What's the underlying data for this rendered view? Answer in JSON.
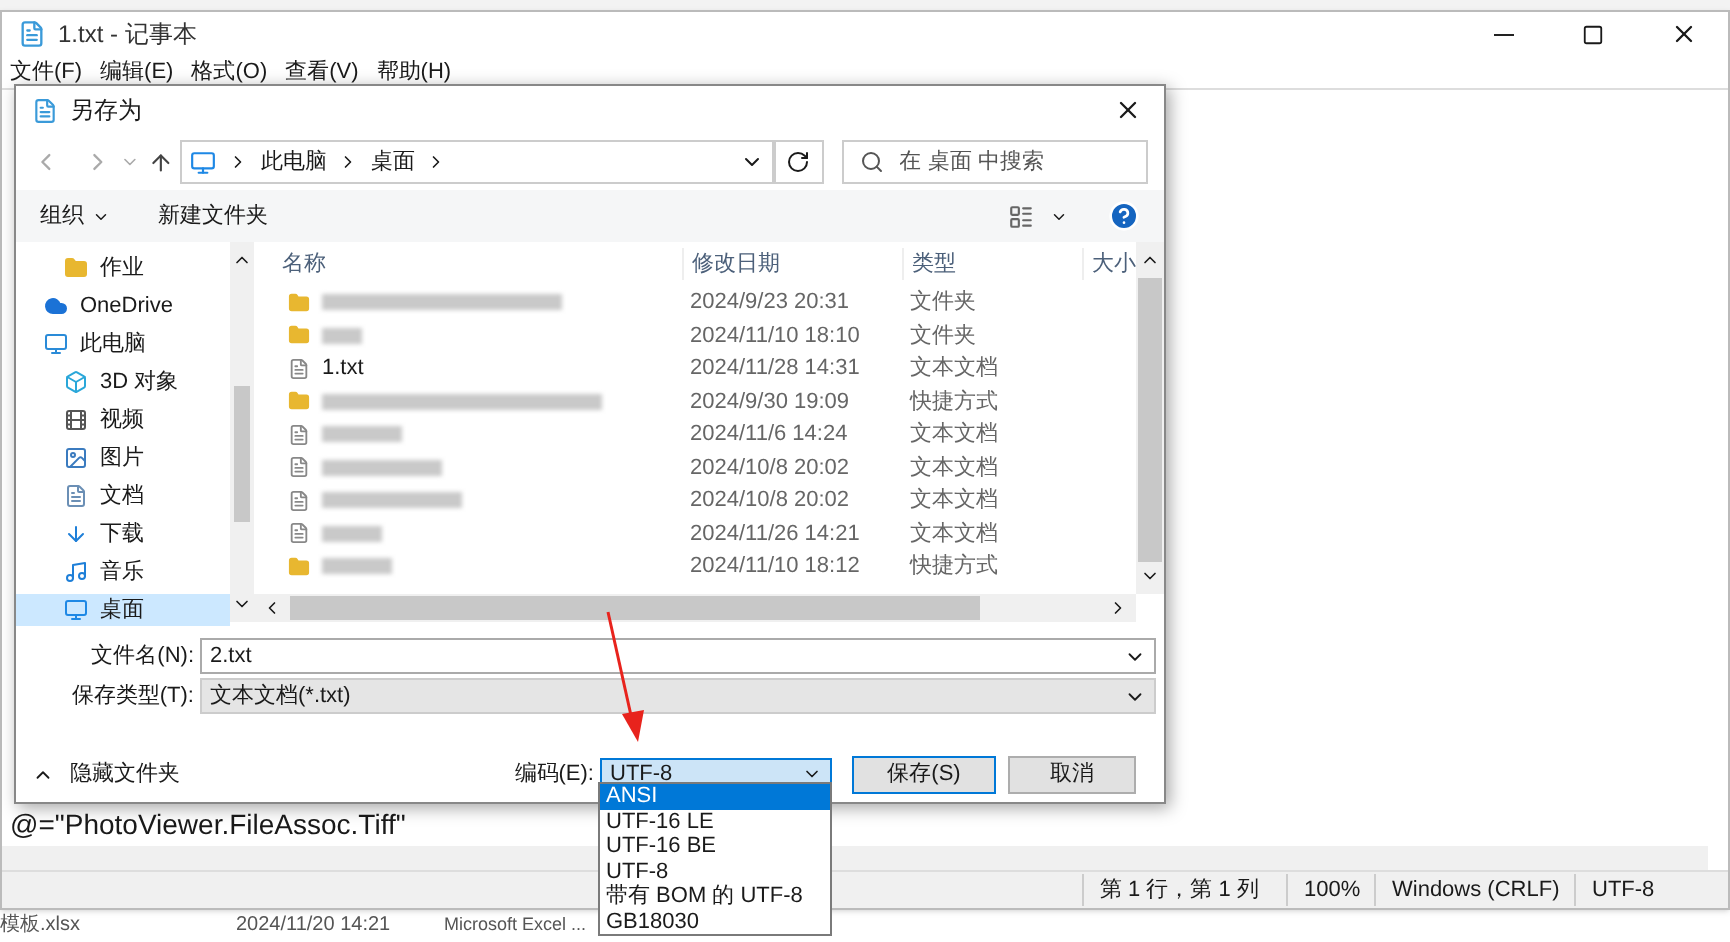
{
  "notepad": {
    "title": "1.txt - 记事本",
    "menu": [
      "文件(F)",
      "编辑(E)",
      "格式(O)",
      "查看(V)",
      "帮助(H)"
    ],
    "text_line": "@=\"PhotoViewer.FileAssoc.Tiff\"",
    "status_bar": [
      "第 1 行，第 1 列",
      "100%",
      "Windows (CRLF)",
      "UTF-8"
    ]
  },
  "dialog": {
    "title": "另存为",
    "breadcrumb": [
      "此电脑",
      "桌面"
    ],
    "search": {
      "placeholder": "在 桌面 中搜索"
    },
    "toolbar": {
      "organize": "组织",
      "new_folder": "新建文件夹"
    },
    "nav": [
      {
        "kind": "folder",
        "label": "作业",
        "selected": false
      },
      {
        "kind": "cloud",
        "label": "OneDrive",
        "selected": false
      },
      {
        "kind": "pc",
        "label": "此电脑",
        "selected": false
      },
      {
        "kind": "cube",
        "label": "3D 对象",
        "selected": false
      },
      {
        "kind": "video",
        "label": "视频",
        "selected": false
      },
      {
        "kind": "image",
        "label": "图片",
        "selected": false
      },
      {
        "kind": "doc",
        "label": "文档",
        "selected": false
      },
      {
        "kind": "download",
        "label": "下载",
        "selected": false
      },
      {
        "kind": "music",
        "label": "音乐",
        "selected": false
      },
      {
        "kind": "desktop",
        "label": "桌面",
        "selected": true
      }
    ],
    "columns": [
      "名称",
      "修改日期",
      "类型",
      "大小"
    ],
    "files": [
      {
        "kind": "folder",
        "date": "2024/9/23 20:31",
        "type": "文件夹"
      },
      {
        "kind": "folder",
        "date": "2024/11/10 18:10",
        "type": "文件夹"
      },
      {
        "kind": "text",
        "name": "1.txt",
        "date": "2024/11/28 14:31",
        "type": "文本文档"
      },
      {
        "kind": "shortcut",
        "date": "2024/9/30 19:09",
        "type": "快捷方式"
      },
      {
        "kind": "text",
        "date": "2024/11/6 14:24",
        "type": "文本文档"
      },
      {
        "kind": "text",
        "date": "2024/10/8 20:02",
        "type": "文本文档"
      },
      {
        "kind": "text",
        "date": "2024/10/8 20:02",
        "type": "文本文档"
      },
      {
        "kind": "text",
        "date": "2024/11/26 14:21",
        "type": "文本文档"
      },
      {
        "kind": "shortcut",
        "date": "2024/11/10 18:12",
        "type": "快捷方式"
      }
    ],
    "filename": {
      "label": "文件名(N):",
      "value": "2.txt"
    },
    "filetype": {
      "label": "保存类型(T):",
      "value": "文本文档(*.txt)"
    },
    "hide_folders": "隐藏文件夹",
    "encoding": {
      "label": "编码(E):",
      "value": "UTF-8",
      "expanded": true,
      "options": [
        {
          "label": "ANSI",
          "highlighted": true
        },
        {
          "label": "UTF-16 LE",
          "highlighted": false
        },
        {
          "label": "UTF-16 BE",
          "highlighted": false
        },
        {
          "label": "UTF-8",
          "highlighted": false
        },
        {
          "label": "带有 BOM 的 UTF-8",
          "highlighted": false
        },
        {
          "label": "GB18030",
          "highlighted": false
        }
      ]
    },
    "buttons": [
      "保存(S)",
      "取消"
    ]
  },
  "background_row": {
    "name": "模板.xlsx",
    "date": "2024/11/20 14:21",
    "type": "Microsoft Excel ..."
  }
}
